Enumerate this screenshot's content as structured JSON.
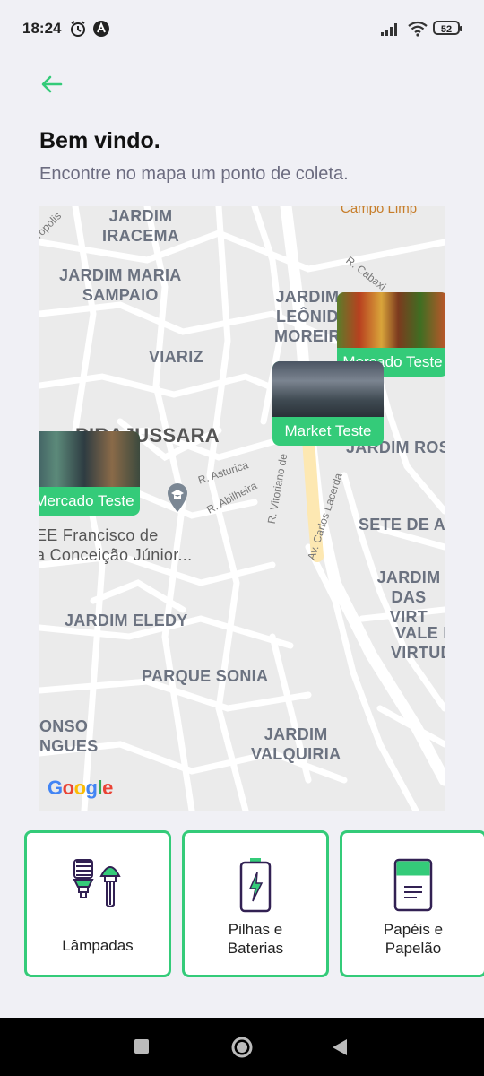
{
  "status": {
    "time": "18:24",
    "battery": "52"
  },
  "header": {
    "title": "Bem vindo.",
    "subtitle": "Encontre no mapa um ponto de coleta."
  },
  "map": {
    "labels": {
      "jardim_iracema": "JARDIM\nIRACEMA",
      "jardim_maria_sampaio": "JARDIM MARIA\nSAMPAIO",
      "jardim_leonidas": "JARDIM\nLEÔNID\nMOREIR",
      "viariz": "VIARIZ",
      "piraj": "PIRAJUSSARA",
      "jardim_rosa": "JARDIM ROSA",
      "sete_de_abril": "SETE DE AB",
      "jardim_das_virt": "JARDIM\nDAS VIRT",
      "vale_virtudes": "VALE I\nVIRTUD",
      "jardim_eledy": "JARDIM ELEDY",
      "parque_sonia": "PARQUE SONIA",
      "jardim_valquiria": "JARDIM\nVALQUIRIA",
      "afonso": "ONSO\nNGUES",
      "r_cabaxi": "R. Cabaxi",
      "r_asturica": "R. Asturica",
      "r_abilheira": "R. Abilheira",
      "r_vitoriano": "R. Vitoriano de",
      "av_carlos_lacerda": "Av. Carlos Lacerda",
      "ropolis": "ropolis",
      "campo_limpo": "Campo Limp",
      "school": "EE Francisco de\na Conceição Júnior..."
    },
    "pins": [
      {
        "label": "Mercado Teste"
      },
      {
        "label": "Market Teste"
      },
      {
        "label": "Mercado Teste"
      }
    ],
    "attribution": [
      "G",
      "o",
      "o",
      "g",
      "l",
      "e"
    ]
  },
  "items": [
    {
      "label": "Lâmpadas",
      "icon": "lamps-icon"
    },
    {
      "label": "Pilhas e\nBaterias",
      "icon": "battery-icon"
    },
    {
      "label": "Papéis e\nPapelão",
      "icon": "paper-icon"
    }
  ],
  "colors": {
    "accent": "#34cb79",
    "background": "#f0f0f5"
  }
}
